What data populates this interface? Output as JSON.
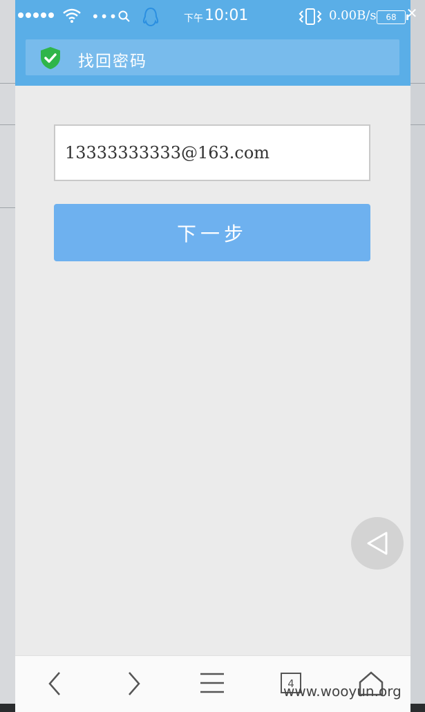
{
  "status_bar": {
    "time_prefix": "下午",
    "time": "10:01",
    "net_speed": "0.00B/s",
    "battery": "68",
    "signal_icon": "signal-dots-icon",
    "wifi_icon": "wifi-icon",
    "qq_icon": "qq-penguin-icon"
  },
  "header": {
    "title": "找回密码",
    "icon": "shield-check-icon",
    "accent": "#5aaee7"
  },
  "form": {
    "email_value": "13333333333@163.com",
    "next_label": "下一步",
    "button_color": "#6eb1ef"
  },
  "navbar": {
    "tab_count": "4",
    "icons": [
      "back-arrow-icon",
      "forward-arrow-icon",
      "menu-icon",
      "tabs-icon",
      "home-icon"
    ]
  },
  "watermark": "www.wooyun.org"
}
